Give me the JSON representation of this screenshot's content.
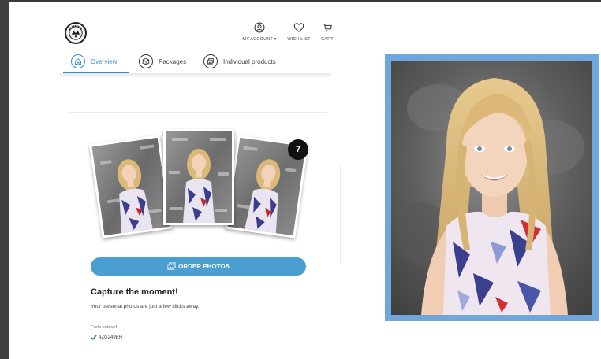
{
  "header": {
    "account_label": "MY ACCOUNT",
    "wishlist_label": "WISH LIST",
    "cart_label": "CART"
  },
  "tabs": [
    {
      "label": "Overview",
      "icon": "home-icon",
      "active": true
    },
    {
      "label": "Packages",
      "icon": "box-icon",
      "active": false
    },
    {
      "label": "Individual products",
      "icon": "photos-icon",
      "active": false
    }
  ],
  "preview": {
    "photo_count": "7"
  },
  "order_button_label": "ORDER PHOTOS",
  "headline": "Capture the moment!",
  "subline": "Your personal photos are just a few clicks away.",
  "code": {
    "label": "Code entered:",
    "value": "4ZG249EH"
  },
  "colors": {
    "accent": "#2e8fcf",
    "button": "#4b9fd0",
    "portrait_frame": "#6fa6dc",
    "check": "#2e8b3a"
  }
}
